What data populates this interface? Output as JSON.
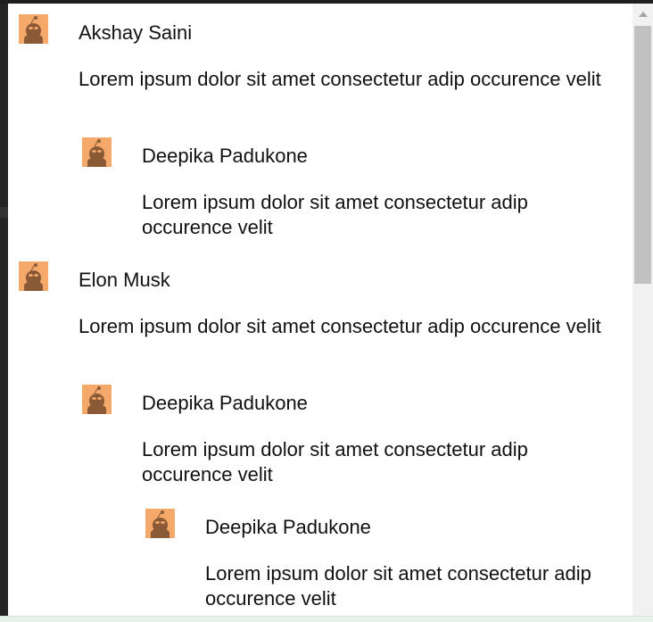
{
  "comments": [
    {
      "name": "Akshay Saini",
      "text": "Lorem ipsum dolor sit amet consectetur adip occurence velit",
      "replies": [
        {
          "name": "Deepika Padukone",
          "text": "Lorem ipsum dolor sit amet consectetur adip occurence velit"
        }
      ]
    },
    {
      "name": "Elon Musk",
      "text": "Lorem ipsum dolor sit amet consectetur adip occurence velit",
      "replies": [
        {
          "name": "Deepika Padukone",
          "text": "Lorem ipsum dolor sit amet consectetur adip occurence velit",
          "replies": [
            {
              "name": "Deepika Padukone",
              "text": "Lorem ipsum dolor sit amet consectetur adip occurence velit"
            }
          ]
        }
      ]
    }
  ],
  "avatar_icon": "user-avatar-icon",
  "colors": {
    "avatar_bg": "#f4a96a",
    "avatar_fg": "#8a5a36"
  }
}
